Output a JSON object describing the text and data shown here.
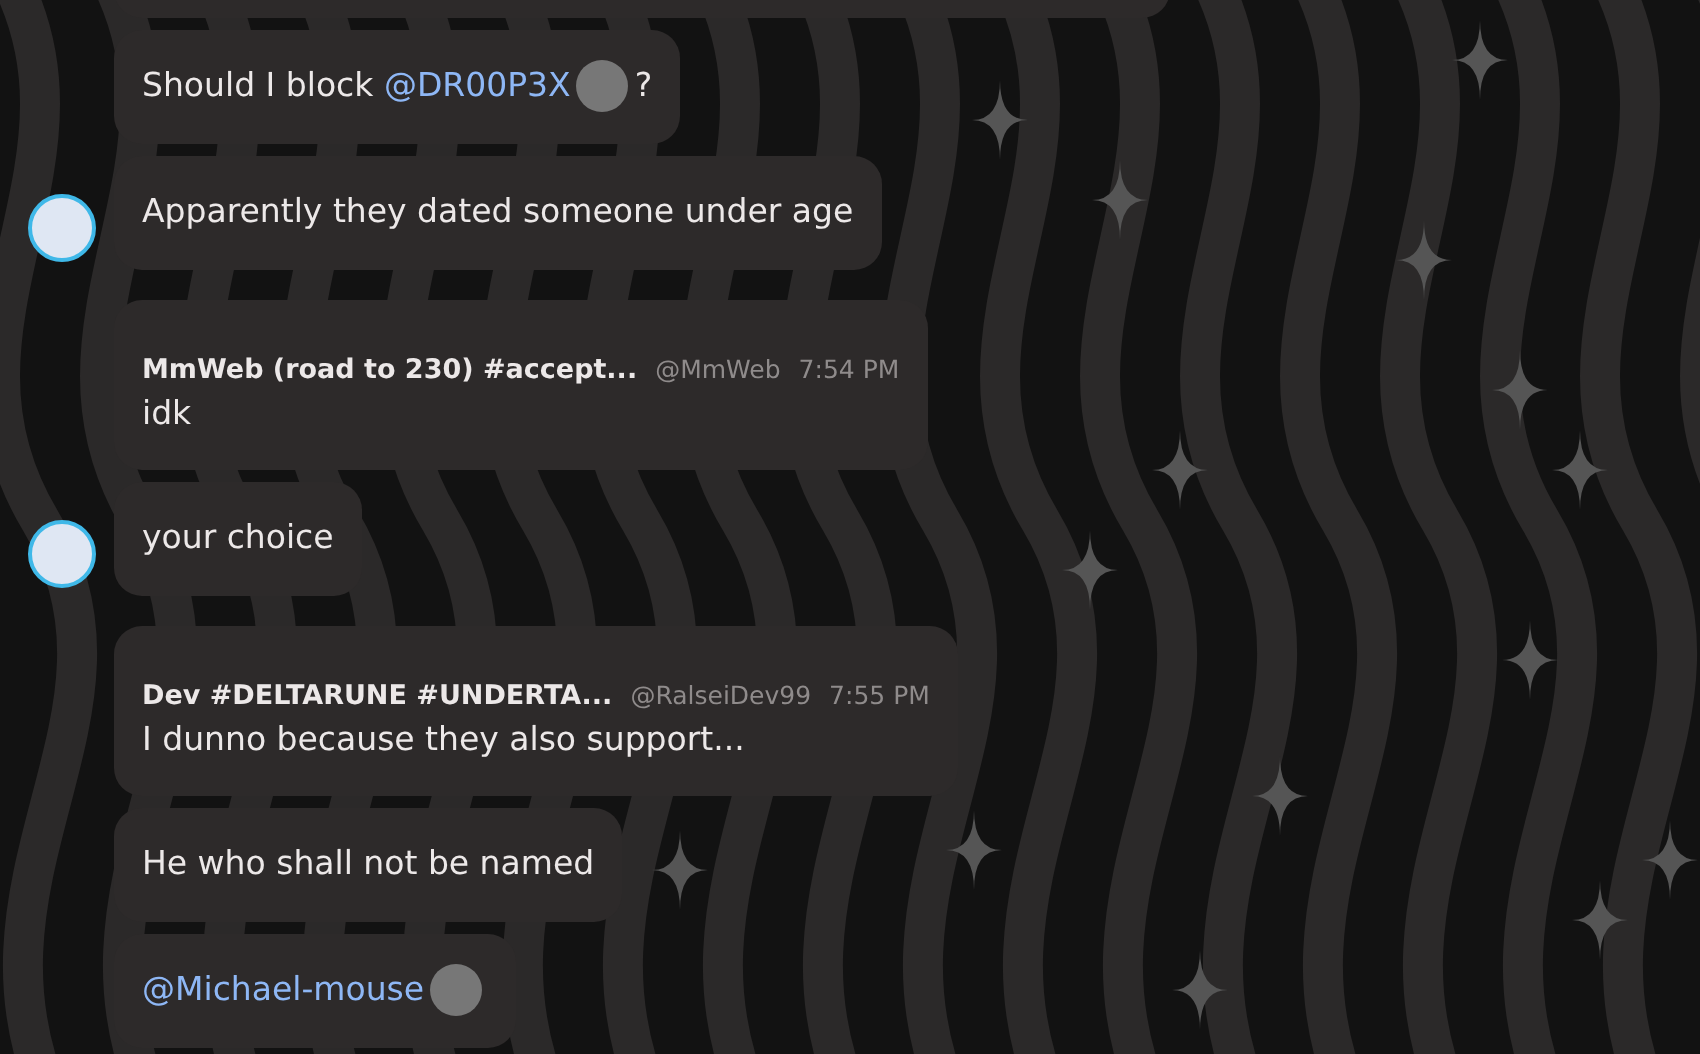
{
  "messages": [
    {
      "avatar": false,
      "parts": [
        {
          "kind": "text",
          "text": "Should I block "
        },
        {
          "kind": "mention",
          "text": "@DR00P3X"
        },
        {
          "kind": "emoji"
        },
        {
          "kind": "text",
          "text": "?"
        }
      ]
    },
    {
      "avatar": true,
      "parts": [
        {
          "kind": "text",
          "text": "Apparently they dated someone under age"
        }
      ]
    },
    {
      "avatar": false,
      "header": {
        "name": "MmWeb (road to 230) #accept...",
        "handle": "@MmWeb",
        "time": "7:54 PM"
      },
      "parts": [
        {
          "kind": "text",
          "text": "idk"
        }
      ]
    },
    {
      "avatar": true,
      "parts": [
        {
          "kind": "text",
          "text": "your choice"
        }
      ]
    },
    {
      "avatar": false,
      "header": {
        "name": "Dev #DELTARUNE #UNDERTA...",
        "handle": "@RalseiDev99",
        "time": "7:55 PM"
      },
      "parts": [
        {
          "kind": "text",
          "text": "I dunno because they also support..."
        }
      ]
    },
    {
      "avatar": false,
      "parts": [
        {
          "kind": "text",
          "text": "He who shall not be named"
        }
      ]
    },
    {
      "avatar": false,
      "parts": [
        {
          "kind": "mention",
          "text": "@Michael-mouse"
        },
        {
          "kind": "emoji"
        }
      ]
    }
  ]
}
